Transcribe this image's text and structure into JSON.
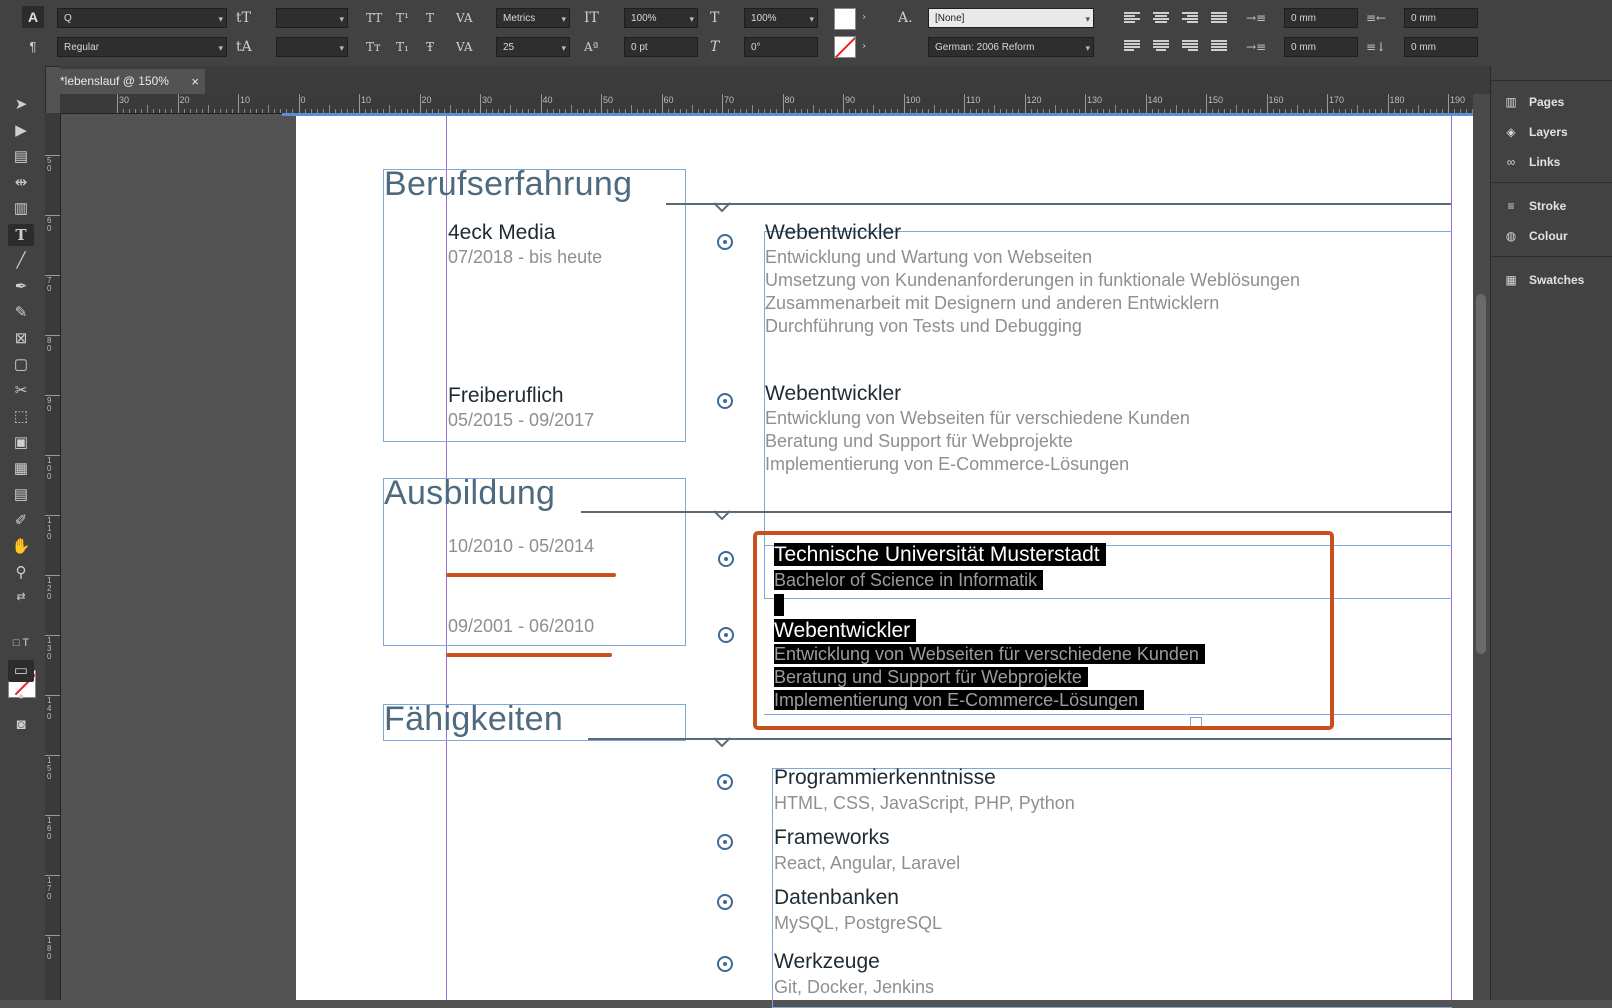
{
  "control_bar": {
    "font_search": "Q",
    "font_style": "Regular",
    "kerning": "Metrics",
    "tracking": "25",
    "vscale": "100%",
    "hscale": "100%",
    "baseline": "0 pt",
    "skew": "0°",
    "char_style": "[None]",
    "language": "German: 2006 Reform",
    "indent_left": "0 mm",
    "indent_right": "0 mm",
    "space_before": "0 mm",
    "space_after": "0 mm"
  },
  "tab": {
    "title": "*lebenslauf @ 150%",
    "close": "×"
  },
  "ruler_h_ticks": [
    "30",
    "20",
    "10",
    "0",
    "10",
    "20",
    "30",
    "40",
    "50",
    "60",
    "70",
    "80",
    "90",
    "100",
    "110",
    "120",
    "130",
    "140",
    "150",
    "160",
    "170",
    "180",
    "190"
  ],
  "ruler_v_ticks": [
    "5 0",
    "6 0",
    "7 0",
    "8 0",
    "9 0",
    "1 0 0",
    "1 1 0",
    "1 2 0",
    "1 3 0",
    "1 4 0",
    "1 5 0",
    "1 6 0",
    "1 7 0",
    "1 8 0"
  ],
  "panel": {
    "items": [
      "Pages",
      "Layers",
      "Links",
      "Stroke",
      "Colour",
      "Swatches"
    ]
  },
  "resume": {
    "sections": {
      "berufserfahrung": "Berufserfahrung",
      "ausbildung": "Ausbildung",
      "faehigkeiten": "Fähigkeiten"
    },
    "jobs": [
      {
        "company": "4eck Media",
        "dates": "07/2018 -  bis heute",
        "title": "Webentwickler",
        "lines": [
          "Entwicklung und Wartung von Webseiten",
          "Umsetzung von Kundenanforderungen in funktionale Weblösungen",
          "Zusammenarbeit mit Designern und anderen Entwicklern",
          "Durchführung von Tests und Debugging"
        ]
      },
      {
        "company": "Freiberuflich",
        "dates": "05/2015 - 09/2017",
        "title": "Webentwickler",
        "lines": [
          "Entwicklung von Webseiten für verschiedene Kunden",
          "Beratung und Support für Webprojekte",
          "Implementierung von E-Commerce-Lösungen"
        ]
      }
    ],
    "education": [
      {
        "dates": "10/2010 - 05/2014",
        "title": "Technische Universität Musterstadt",
        "lines": [
          "Bachelor of Science in Informatik"
        ]
      },
      {
        "dates": "09/2001 - 06/2010",
        "title": "Webentwickler",
        "lines": [
          "Entwicklung von Webseiten für verschiedene Kunden",
          "Beratung und Support für Webprojekte",
          "Implementierung von E-Commerce-Lösungen"
        ]
      }
    ],
    "skills": [
      {
        "title": "Programmierkenntnisse",
        "value": "HTML, CSS, JavaScript, PHP, Python"
      },
      {
        "title": "Frameworks",
        "value": "React, Angular, Laravel"
      },
      {
        "title": "Datenbanken",
        "value": "MySQL, PostgreSQL"
      },
      {
        "title": "Werkzeuge",
        "value": "Git, Docker, Jenkins"
      }
    ]
  },
  "colors": {
    "accent_annotation": "#c8501c",
    "heading": "#4d6a7f",
    "frame_guide": "#7ea8d8"
  }
}
